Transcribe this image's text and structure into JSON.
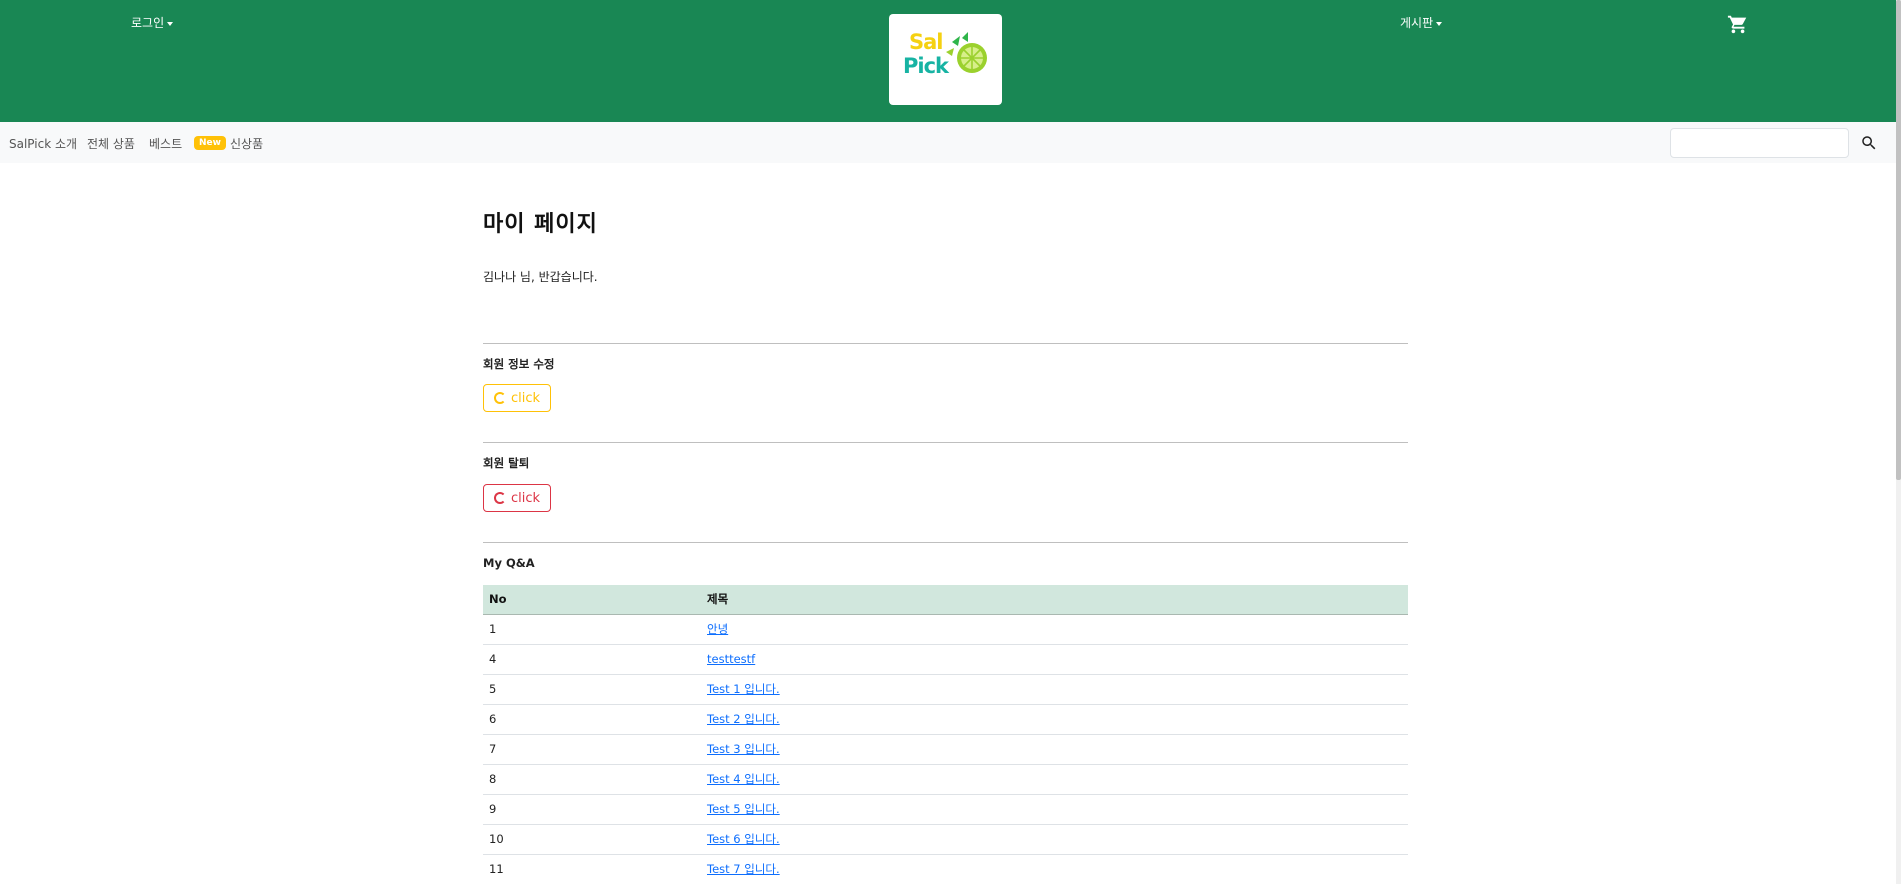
{
  "header": {
    "login_label": "로그인",
    "board_label": "게시판",
    "logo_top": "Sal",
    "logo_bottom": "Pick",
    "brand_color": "#198754",
    "cart_icon": "cart-icon"
  },
  "subnav": {
    "items": [
      "SalPick 소개",
      "전체 상품",
      "베스트",
      "신상품"
    ],
    "badge": "New",
    "search_placeholder": "",
    "search_icon": "search-icon"
  },
  "main": {
    "title": "마이 페이지",
    "greeting": "김나나 님, 반갑습니다.",
    "edit_label": "회원 정보 수정",
    "edit_button": "click",
    "withdraw_label": "회원 탈퇴",
    "withdraw_button": "click",
    "qa_label": "My Q&A",
    "table": {
      "columns": [
        "No",
        "제목"
      ],
      "rows": [
        {
          "no": "1",
          "title": "안녕"
        },
        {
          "no": "4",
          "title": "testtestf"
        },
        {
          "no": "5",
          "title": "Test 1 입니다."
        },
        {
          "no": "6",
          "title": "Test 2 입니다."
        },
        {
          "no": "7",
          "title": "Test 3 입니다."
        },
        {
          "no": "8",
          "title": "Test 4 입니다."
        },
        {
          "no": "9",
          "title": "Test 5 입니다."
        },
        {
          "no": "10",
          "title": "Test 6 입니다."
        },
        {
          "no": "11",
          "title": "Test 7 입니다."
        }
      ]
    }
  }
}
